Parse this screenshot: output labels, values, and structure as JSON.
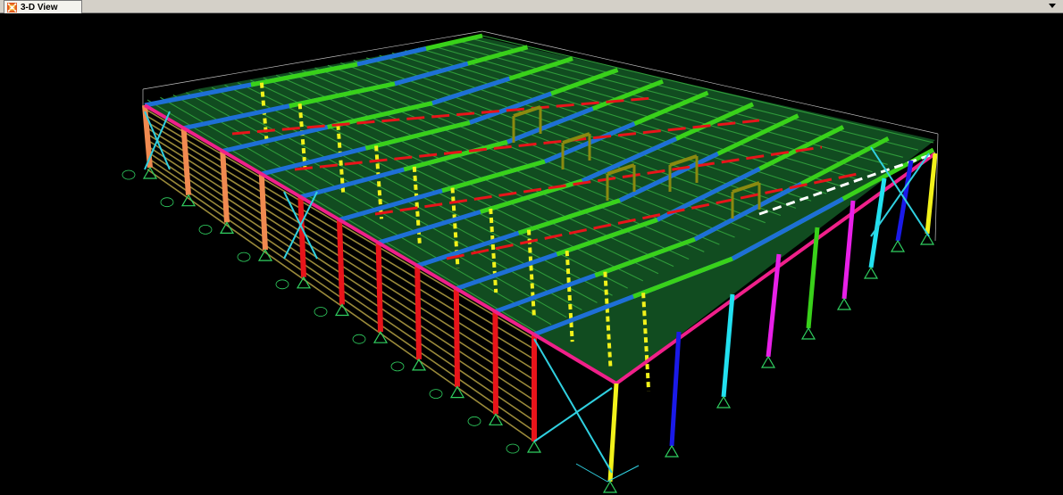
{
  "window": {
    "tab_title": "3-D View"
  },
  "icons": {
    "tab_icon": "structure-app-icon",
    "dropdown": "chevron-down-icon"
  },
  "colors": {
    "background": "#000000",
    "purlin": "#3a7a2a",
    "roof_grid": "#1f8a3a",
    "rafter_blue": "#1e6fd6",
    "rafter_green": "#39d11a",
    "beam_red": "#e8141a",
    "column_red": "#e8141a",
    "column_yellow": "#f2f21a",
    "column_orange": "#f08a50",
    "column_cyan": "#22e0f0",
    "column_magenta": "#e820e8",
    "column_blue": "#1a1ae8",
    "eave_pink": "#f0208a",
    "wall_girt": "#9a8a3a",
    "brace_cyan": "#30d0e0",
    "support": "#30d060",
    "grid_line": "#bfbfbf"
  }
}
